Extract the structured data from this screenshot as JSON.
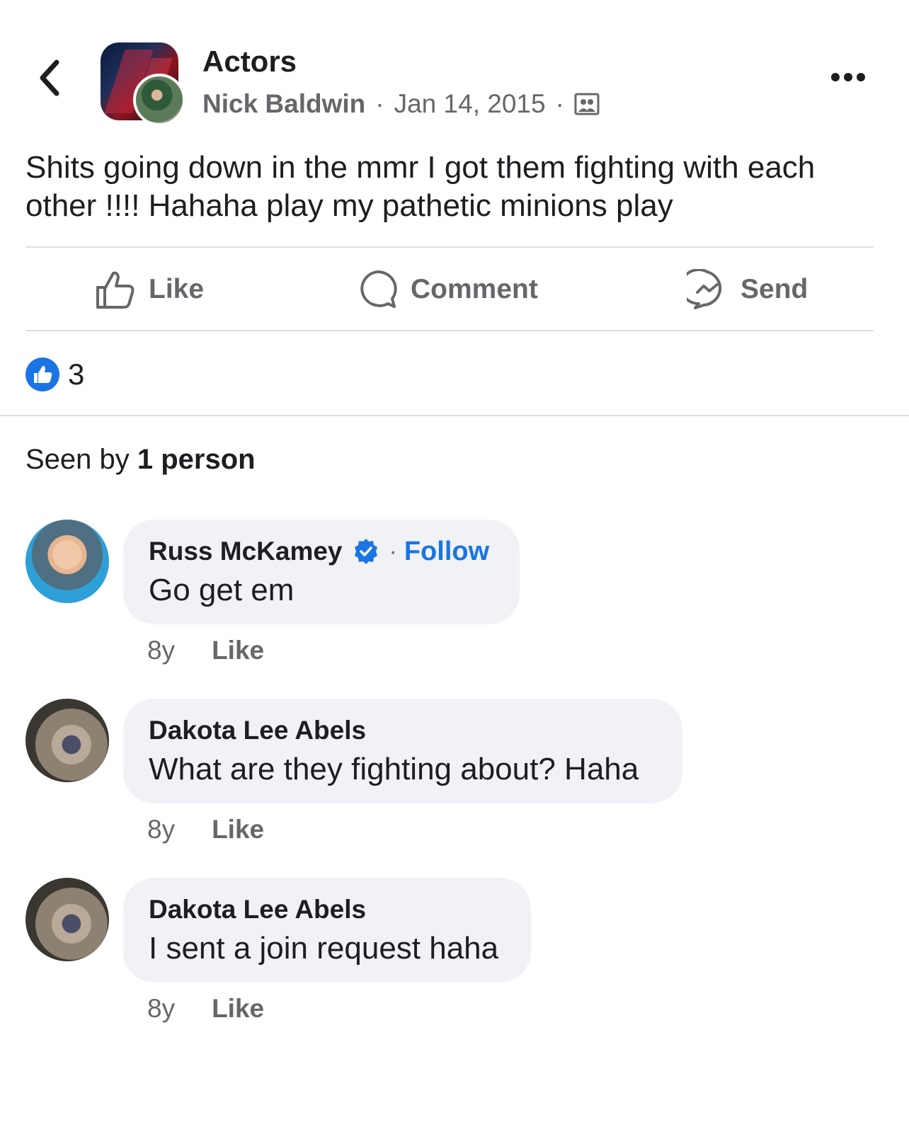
{
  "header": {
    "group_name": "Actors",
    "author": "Nick Baldwin",
    "separator": "·",
    "date": "Jan 14, 2015",
    "audience_icon": "group-audience-icon"
  },
  "post": {
    "text": "Shits going down in the mmr I got them fighting with each other !!!! Hahaha play my pathetic minions play"
  },
  "actions": {
    "like": "Like",
    "comment": "Comment",
    "send": "Send"
  },
  "reactions": {
    "count": "3",
    "icon": "like-reaction-icon"
  },
  "seen": {
    "prefix": "Seen by ",
    "count_text": "1 person"
  },
  "comments": [
    {
      "name": "Russ McKamey",
      "verified": true,
      "follow": "Follow",
      "separator": "·",
      "text": "Go get em",
      "time": "8y",
      "like": "Like"
    },
    {
      "name": "Dakota Lee Abels",
      "text": "What are they fighting about? Haha",
      "time": "8y",
      "like": "Like"
    },
    {
      "name": "Dakota Lee Abels",
      "text": "I sent a join request haha",
      "time": "8y",
      "like": "Like"
    }
  ],
  "colors": {
    "accent": "#1b74e4",
    "secondary_text": "#65676b",
    "bubble_bg": "#f0f2f5",
    "divider": "#dddfe2"
  }
}
